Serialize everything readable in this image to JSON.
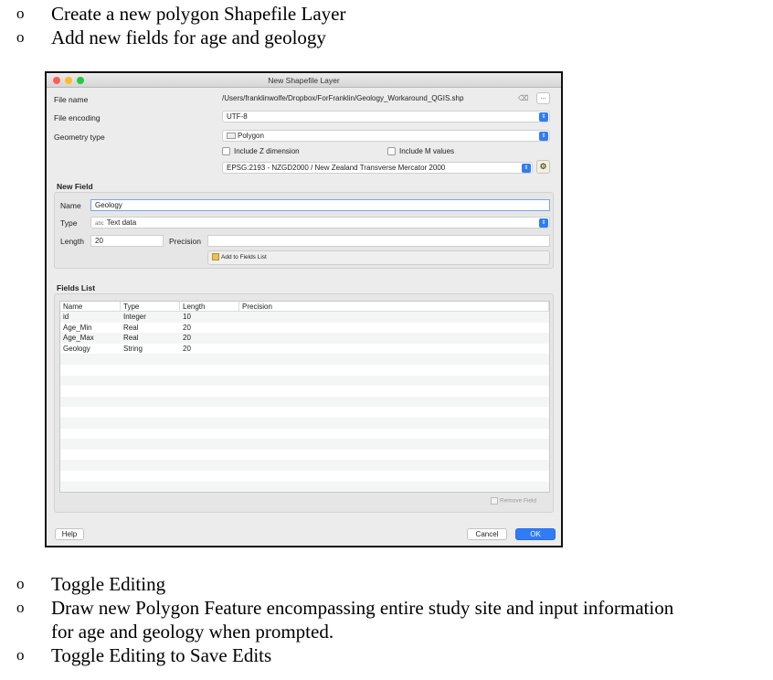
{
  "bullets_top": [
    {
      "mark": "o",
      "text": "Create a new polygon Shapefile Layer"
    },
    {
      "mark": "o",
      "text": "Add new fields for age and geology"
    }
  ],
  "bullets_bottom": [
    {
      "mark": "o",
      "text": "Toggle Editing"
    },
    {
      "mark": "o",
      "text": "Draw new Polygon Feature encompassing entire study site and input information"
    },
    {
      "mark": "",
      "text": "for age and geology when prompted."
    },
    {
      "mark": "o",
      "text": "Toggle Editing to Save Edits"
    }
  ],
  "dialog": {
    "title": "New Shapefile Layer",
    "file_name_label": "File name",
    "file_name_value": "/Users/franklinwolfe/Dropbox/ForFranklin/Geology_Workaround_QGIS.shp",
    "clear_glyph": "⌫",
    "browse_label": "...",
    "file_encoding_label": "File encoding",
    "file_encoding_value": "UTF-8",
    "geometry_type_label": "Geometry type",
    "geometry_type_value": "Polygon",
    "include_z_label": "Include Z dimension",
    "include_m_label": "Include M values",
    "crs_value": "EPSG:2193 - NZGD2000 / New Zealand Transverse Mercator 2000",
    "new_field": {
      "title": "New Field",
      "name_label": "Name",
      "name_value": "Geology",
      "type_label": "Type",
      "type_prefix": "abc",
      "type_value": "Text data",
      "length_label": "Length",
      "length_value": "20",
      "precision_label": "Precision",
      "precision_value": "",
      "add_button": "Add to Fields List"
    },
    "fields_list": {
      "title": "Fields List",
      "columns": [
        "Name",
        "Type",
        "Length",
        "Precision"
      ],
      "rows": [
        [
          "id",
          "Integer",
          "10",
          ""
        ],
        [
          "Age_Min",
          "Real",
          "20",
          ""
        ],
        [
          "Age_Max",
          "Real",
          "20",
          ""
        ],
        [
          "Geology",
          "String",
          "20",
          ""
        ]
      ],
      "empty_rows": 14,
      "remove_button": "Remove Field"
    },
    "help_button": "Help",
    "cancel_button": "Cancel",
    "ok_button": "OK"
  },
  "colors": {
    "accent": "#2f7cf6"
  }
}
